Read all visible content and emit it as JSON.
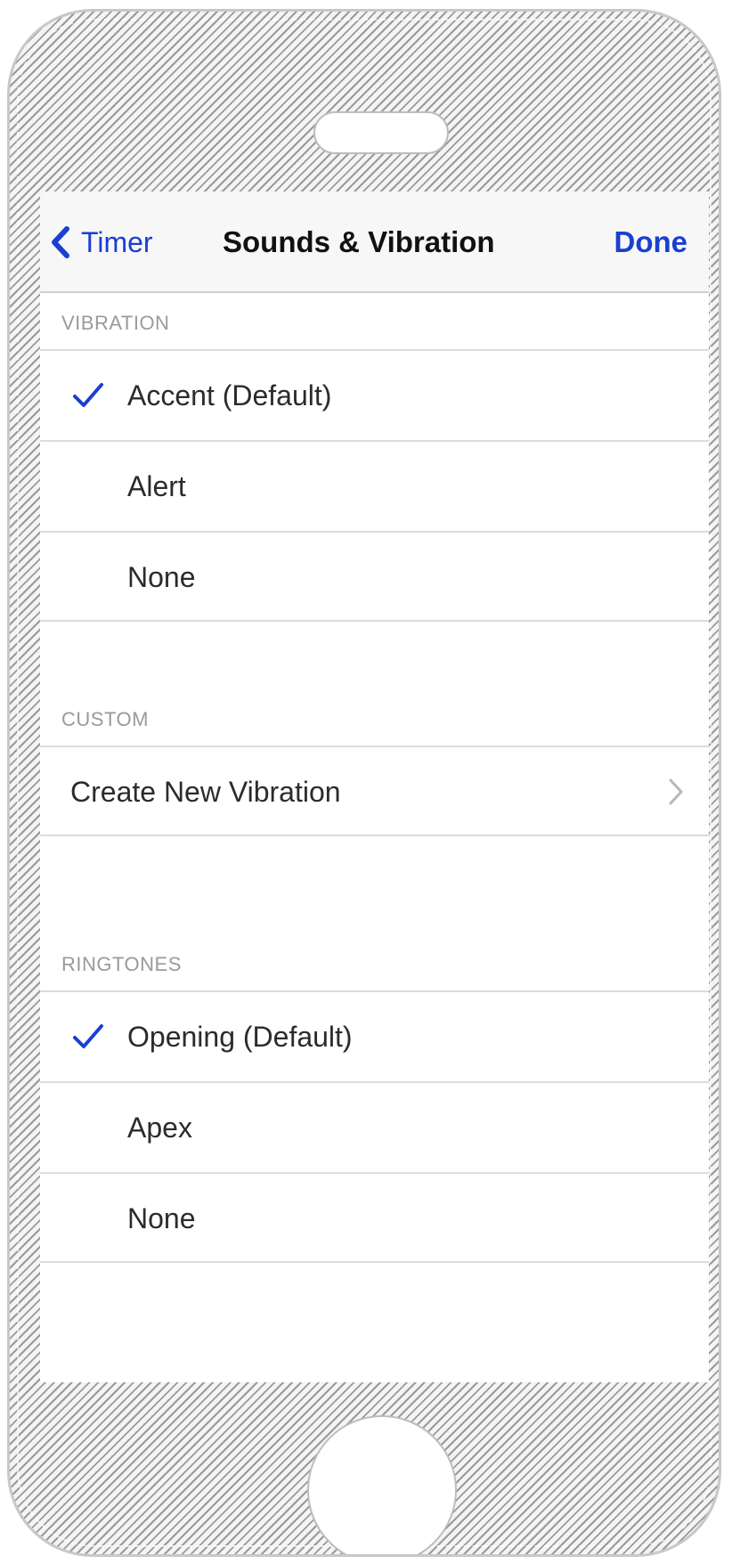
{
  "navbar": {
    "back_label": "Timer",
    "title": "Sounds & Vibration",
    "done_label": "Done"
  },
  "colors": {
    "accent": "#1a3fd1",
    "section_header": "#9a9a9a"
  },
  "vibration": {
    "header": "VIBRATION",
    "items": [
      {
        "label": "Accent (Default)",
        "checked": true
      },
      {
        "label": "Alert",
        "checked": false
      },
      {
        "label": "None",
        "checked": false
      }
    ]
  },
  "custom": {
    "header": "CUSTOM",
    "items": [
      {
        "label": "Create New Vibration",
        "icon": "chevron-right-icon"
      }
    ]
  },
  "ringtones": {
    "header": "RINGTONES",
    "items": [
      {
        "label": "Opening (Default)",
        "checked": true
      },
      {
        "label": "Apex",
        "checked": false
      },
      {
        "label": "None",
        "checked": false
      }
    ]
  }
}
